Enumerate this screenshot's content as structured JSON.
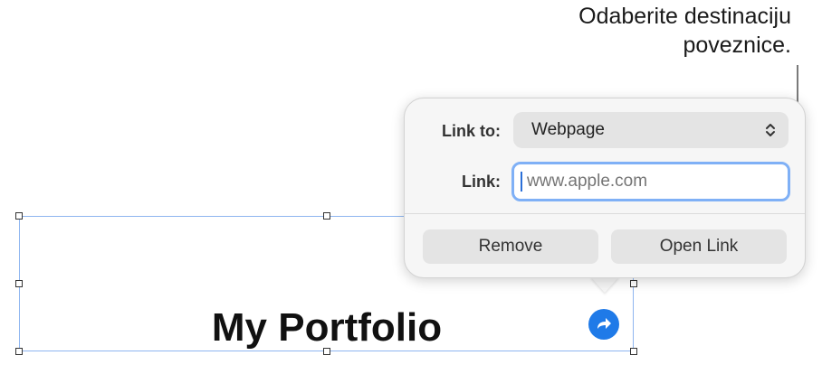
{
  "callout": {
    "line1": "Odaberite destinaciju",
    "line2": "poveznice."
  },
  "document": {
    "title": "My Portfolio"
  },
  "popover": {
    "link_to_label": "Link to:",
    "link_to_value": "Webpage",
    "link_label": "Link:",
    "link_placeholder": "www.apple.com",
    "link_value": "",
    "remove_label": "Remove",
    "open_link_label": "Open Link"
  },
  "icons": {
    "link_arrow": "arrow-turn-right-icon",
    "select_arrows": "chevron-up-down-icon"
  },
  "colors": {
    "accent": "#1f7ae8",
    "focus_ring": "#7fb0f6",
    "selection": "#8fb6f0"
  }
}
